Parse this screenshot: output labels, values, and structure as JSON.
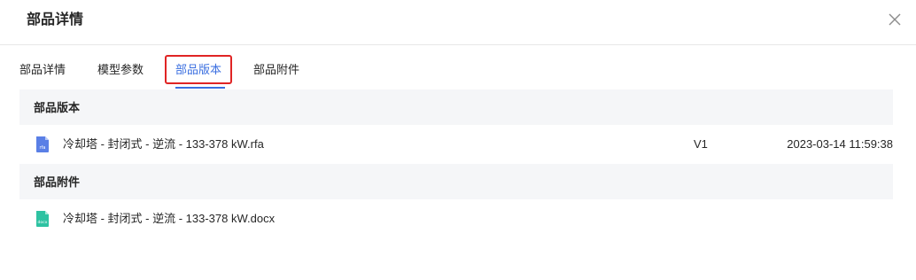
{
  "dialog": {
    "title": "部品详情",
    "close_icon": "close-icon"
  },
  "tabs": [
    {
      "label": "部品详情",
      "active": false
    },
    {
      "label": "模型参数",
      "active": false
    },
    {
      "label": "部品版本",
      "active": true
    },
    {
      "label": "部品附件",
      "active": false
    }
  ],
  "accent_color": "#3b6fe0",
  "highlight_color": "#e02424",
  "sections": {
    "versions": {
      "title": "部品版本",
      "rows": [
        {
          "icon": "rfa-file-icon",
          "icon_label": "rfa",
          "name": "冷却塔 - 封闭式 - 逆流 - 133-378 kW.rfa",
          "version": "V1",
          "time": "2023-03-14 11:59:38"
        }
      ]
    },
    "attachments": {
      "title": "部品附件",
      "rows": [
        {
          "icon": "docx-file-icon",
          "icon_label": "docx",
          "name": "冷却塔 - 封闭式 - 逆流 - 133-378 kW.docx"
        }
      ]
    }
  }
}
